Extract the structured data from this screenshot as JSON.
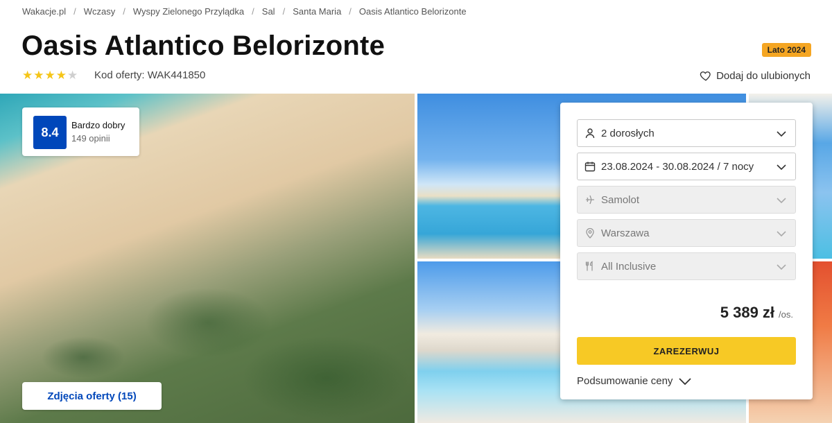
{
  "breadcrumb": [
    "Wakacje.pl",
    "Wczasy",
    "Wyspy Zielonego Przylądka",
    "Sal",
    "Santa Maria",
    "Oasis Atlantico Belorizonte"
  ],
  "breadcrumb_separator": "/",
  "hotel": {
    "title": "Oasis Atlantico Belorizonte",
    "season_badge": "Lato 2024",
    "stars": 4,
    "stars_max": 5,
    "offer_code": "Kod oferty: WAK441850",
    "favorite_label": "Dodaj do ulubionych"
  },
  "rating": {
    "score": "8.4",
    "label": "Bardzo dobry",
    "count": "149 opinii"
  },
  "gallery": {
    "photos_button": "Zdjęcia oferty (15)"
  },
  "booking": {
    "travellers": "2 dorosłych",
    "dates": "23.08.2024 - 30.08.2024 / 7 nocy",
    "transport": "Samolot",
    "departure": "Warszawa",
    "board": "All Inclusive",
    "price": "5 389 zł",
    "price_unit": "/os.",
    "book_button": "ZAREZERWUJ",
    "summary_label": "Podsumowanie ceny"
  },
  "colors": {
    "brand_blue": "#0047ba",
    "cta_yellow": "#f7c925",
    "badge_orange": "#f5a623",
    "star_yellow": "#f5c518"
  }
}
